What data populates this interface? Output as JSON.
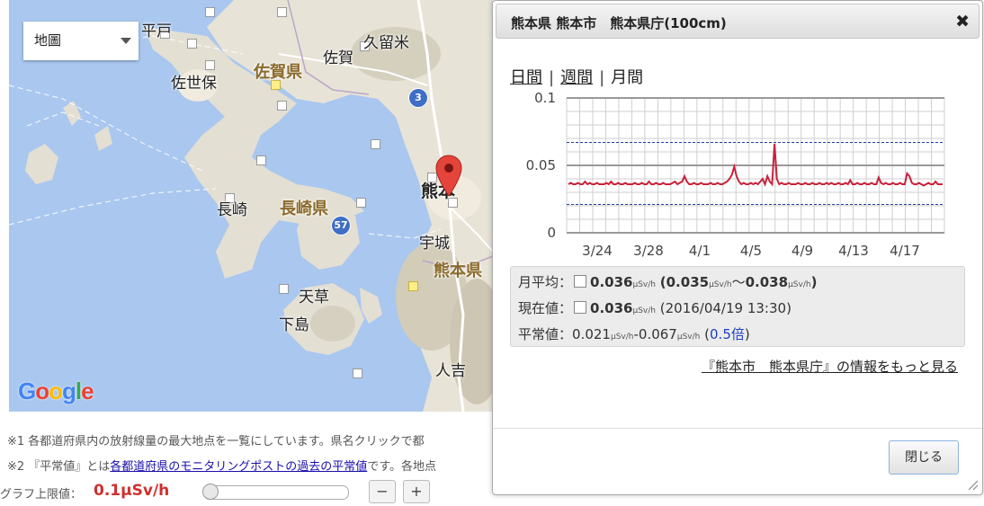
{
  "map": {
    "type_selector": "地圖",
    "logo": "Google",
    "labels": {
      "hirado": "平戸",
      "sasebo": "佐世保",
      "saga_pref": "佐賀県",
      "saga": "佐賀",
      "kurume": "久留米",
      "nagasaki": "長崎",
      "nagasaki_pref": "長崎県",
      "kumamoto": "熊本",
      "uto": "宇城",
      "kumamoto_pref": "熊本県",
      "amakusa": "天草",
      "shimo": "下島",
      "hitoyoshi": "人吉"
    },
    "routes": {
      "r3": "3",
      "r57": "57"
    }
  },
  "notes": {
    "note1": "※1 各都道府県内の放射線量の最大地点を一覧にしています。県名クリックで都",
    "note2_prefix": "※2 『平常値』とは",
    "note2_link": "各都道府県のモニタリングポストの過去の平常値",
    "note2_suffix": "です。各地点"
  },
  "graph_limit": {
    "label": "グラフ上限値：",
    "value": "0.1μSv/h",
    "minus": "−",
    "plus": "+"
  },
  "dialog": {
    "title": "熊本県 熊本市　熊本県庁(100cm)",
    "close_icon": "✖",
    "tabs": {
      "daily": "日間",
      "weekly": "週間",
      "monthly": "月間",
      "sep": "|"
    },
    "stats": {
      "avg_label": "月平均：",
      "avg_value": "0.036",
      "avg_range_open": "(",
      "avg_min": "0.035",
      "avg_tilde": "〜",
      "avg_max": "0.038",
      "avg_range_close": ")",
      "unit": "μSv/h",
      "current_label": "現在値：",
      "current_value": "0.036",
      "current_time": "(2016/04/19 13:30)",
      "normal_label": "平常値：",
      "normal_low": "0.021",
      "normal_dash": "-",
      "normal_high": "0.067",
      "normal_ratio_open": "(",
      "normal_ratio": "0.5倍",
      "normal_ratio_close": ")"
    },
    "more_link": "『熊本市　熊本県庁』の情報をもっと見る",
    "close_button": "閉じる"
  },
  "chart_data": {
    "type": "line",
    "yticks": [
      "0.1",
      "0.05",
      "0"
    ],
    "ylim": [
      0,
      0.1
    ],
    "xticks": [
      "3/24",
      "3/28",
      "4/1",
      "4/5",
      "4/9",
      "4/13",
      "4/17"
    ],
    "reference_lines": [
      0.067,
      0.021
    ],
    "colors": {
      "series": "#c8213b",
      "reference": "#1e3f9e"
    },
    "series": [
      {
        "values": [
          0.036,
          0.037,
          0.036,
          0.036,
          0.037,
          0.036,
          0.036,
          0.038,
          0.036,
          0.037,
          0.036,
          0.036,
          0.037,
          0.036,
          0.036,
          0.036,
          0.037,
          0.036,
          0.038,
          0.036,
          0.036,
          0.037,
          0.036,
          0.036,
          0.037,
          0.036,
          0.036,
          0.036,
          0.037,
          0.036,
          0.036,
          0.037,
          0.036,
          0.036,
          0.038,
          0.036,
          0.036,
          0.037,
          0.036,
          0.036,
          0.037,
          0.036,
          0.036,
          0.036,
          0.037,
          0.038,
          0.036,
          0.037,
          0.038,
          0.042,
          0.038,
          0.036,
          0.036,
          0.037,
          0.036,
          0.036,
          0.037,
          0.036,
          0.036,
          0.036,
          0.037,
          0.036,
          0.036,
          0.037,
          0.036,
          0.036,
          0.037,
          0.038,
          0.04,
          0.043,
          0.049,
          0.042,
          0.038,
          0.036,
          0.037,
          0.036,
          0.036,
          0.037,
          0.036,
          0.037,
          0.036,
          0.038,
          0.04,
          0.036,
          0.042,
          0.038,
          0.036,
          0.066,
          0.04,
          0.036,
          0.037,
          0.036,
          0.036,
          0.037,
          0.036,
          0.036,
          0.036,
          0.037,
          0.036,
          0.036,
          0.037,
          0.036,
          0.036,
          0.037,
          0.036,
          0.036,
          0.037,
          0.036,
          0.036,
          0.037,
          0.036,
          0.037,
          0.036,
          0.036,
          0.037,
          0.036,
          0.036,
          0.037,
          0.036,
          0.039,
          0.036,
          0.036,
          0.037,
          0.036,
          0.036,
          0.037,
          0.036,
          0.036,
          0.037,
          0.036,
          0.036,
          0.041,
          0.037,
          0.036,
          0.037,
          0.036,
          0.036,
          0.037,
          0.036,
          0.036,
          0.037,
          0.036,
          0.036,
          0.044,
          0.042,
          0.037,
          0.036,
          0.036,
          0.037,
          0.036,
          0.035,
          0.036,
          0.037,
          0.036,
          0.036,
          0.038,
          0.036,
          0.036,
          0.036
        ]
      }
    ]
  }
}
